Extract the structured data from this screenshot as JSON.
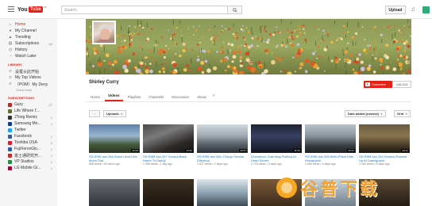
{
  "header": {
    "logo_you": "You",
    "logo_tube": "Tube",
    "logo_region": "HK",
    "search_placeholder": "Search",
    "upload_label": "Upload"
  },
  "sidebar": {
    "main_items": [
      {
        "label": "Home",
        "icon": "home-icon"
      },
      {
        "label": "My Channel",
        "icon": "person-icon"
      },
      {
        "label": "Trending",
        "icon": "flame-icon"
      },
      {
        "label": "Subscriptions",
        "icon": "subscriptions-icon",
        "count": "52"
      },
      {
        "label": "History",
        "icon": "history-icon"
      },
      {
        "label": "Watch Later",
        "icon": "clock-icon"
      }
    ],
    "library_heading": "LIBRARY",
    "library_items": [
      {
        "label": "设置从此开始",
        "icon": "playlist-icon"
      },
      {
        "label": "My Top Videos",
        "icon": "playlist-icon"
      },
      {
        "label": "（POM）My Deny",
        "icon": "playlist-icon"
      }
    ],
    "show_more": "Show more",
    "subscriptions_heading": "SUBSCRIPTIONS",
    "subscriptions": [
      {
        "label": "Gary",
        "count": "27",
        "color": "#b03030"
      },
      {
        "label": "Life Where I'...",
        "count": "",
        "color": "#5a6a3a"
      },
      {
        "label": "JTong Remix",
        "count": "1",
        "color": "#333333"
      },
      {
        "label": "Samsung Mo...",
        "count": "1",
        "color": "#1a3a8a"
      },
      {
        "label": "Twitter",
        "count": "",
        "color": "#1da1f2"
      },
      {
        "label": "Facebook",
        "count": "1",
        "color": "#3b5998"
      },
      {
        "label": "Toshiba USA",
        "count": "2",
        "color": "#d22030"
      },
      {
        "label": "FujiXeroxGlo...",
        "count": "1",
        "color": "#2b5fa8"
      },
      {
        "label": "富士通研究开...",
        "count": "1",
        "color": "#c03030"
      },
      {
        "label": "VP Studios",
        "count": "1",
        "color": "#2a8a4a"
      },
      {
        "label": "LG Mobile Gl...",
        "count": "1",
        "color": "#a6003a"
      }
    ]
  },
  "channel": {
    "name": "Shirley Curry",
    "subscribe_label": "Subscribe",
    "subscriber_count": "146,424",
    "tabs": [
      "Home",
      "Videos",
      "Playlists",
      "Channels",
      "Discussion",
      "About"
    ],
    "active_tab": "Videos"
  },
  "filters": {
    "uploads_label": "Uploads",
    "sort_label": "Date added (newest)",
    "view_label": "Grid"
  },
  "videos": [
    {
      "title": "SKYRIM eps 268 Down Under the Moon Dial",
      "meta": "858 views • 16 hours ago",
      "duration": "22:24"
    },
    {
      "title": "SKYRIM eps 267 Serana Back Home To Daddy",
      "meta": "1,338 views • 1 day ago",
      "duration": "24:53"
    },
    {
      "title": "SKYRIM eps 266 J'Zargo Serana Dilemma",
      "meta": "1,347 views • 2 days ago",
      "duration": "24:47"
    },
    {
      "title": "Grandma's Grab Bag Fishing #1 Dead Secret",
      "meta": "2,718 views • 3 days ago",
      "duration": "32:15"
    },
    {
      "title": "SKYRIM eps 265 Moth Priest Was Kidnapped!",
      "meta": "1,459 views • 4 days ago",
      "duration": "23:21"
    },
    {
      "title": "SKYRIM eps 264 Serana Showed Up At Dawnguard!",
      "meta": "1,442 views • 5 days ago",
      "duration": "24:17"
    }
  ],
  "watermark": {
    "text": "谷普下载"
  }
}
